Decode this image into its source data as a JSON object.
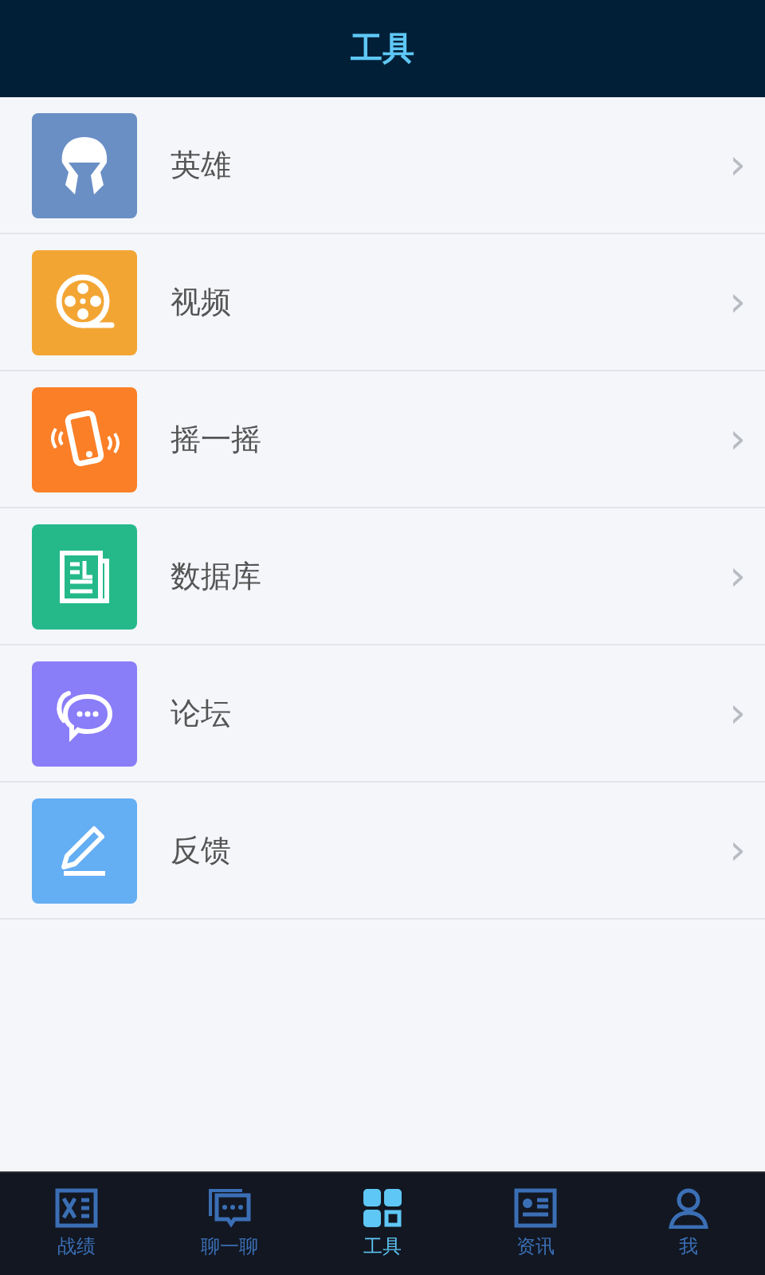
{
  "header": {
    "title": "工具"
  },
  "items": [
    {
      "kind": "helmet",
      "label": "英雄",
      "color": "#6a8fc5",
      "chevron": "›"
    },
    {
      "kind": "film",
      "label": "视频",
      "color": "#f3a534",
      "chevron": "›"
    },
    {
      "kind": "phone",
      "label": "摇一摇",
      "color": "#fb7f27",
      "chevron": "›"
    },
    {
      "kind": "news",
      "label": "数据库",
      "color": "#25b98a",
      "chevron": "›"
    },
    {
      "kind": "chat",
      "label": "论坛",
      "color": "#8a7df8",
      "chevron": "›"
    },
    {
      "kind": "pencil",
      "label": "反馈",
      "color": "#64aef3",
      "chevron": "›"
    }
  ],
  "tabs": [
    {
      "kind": "record",
      "label": "战绩",
      "selected": false
    },
    {
      "kind": "chat",
      "label": "聊一聊",
      "selected": false
    },
    {
      "kind": "grid",
      "label": "工具",
      "selected": true
    },
    {
      "kind": "card",
      "label": "资讯",
      "selected": false
    },
    {
      "kind": "person",
      "label": "我",
      "selected": false
    }
  ]
}
